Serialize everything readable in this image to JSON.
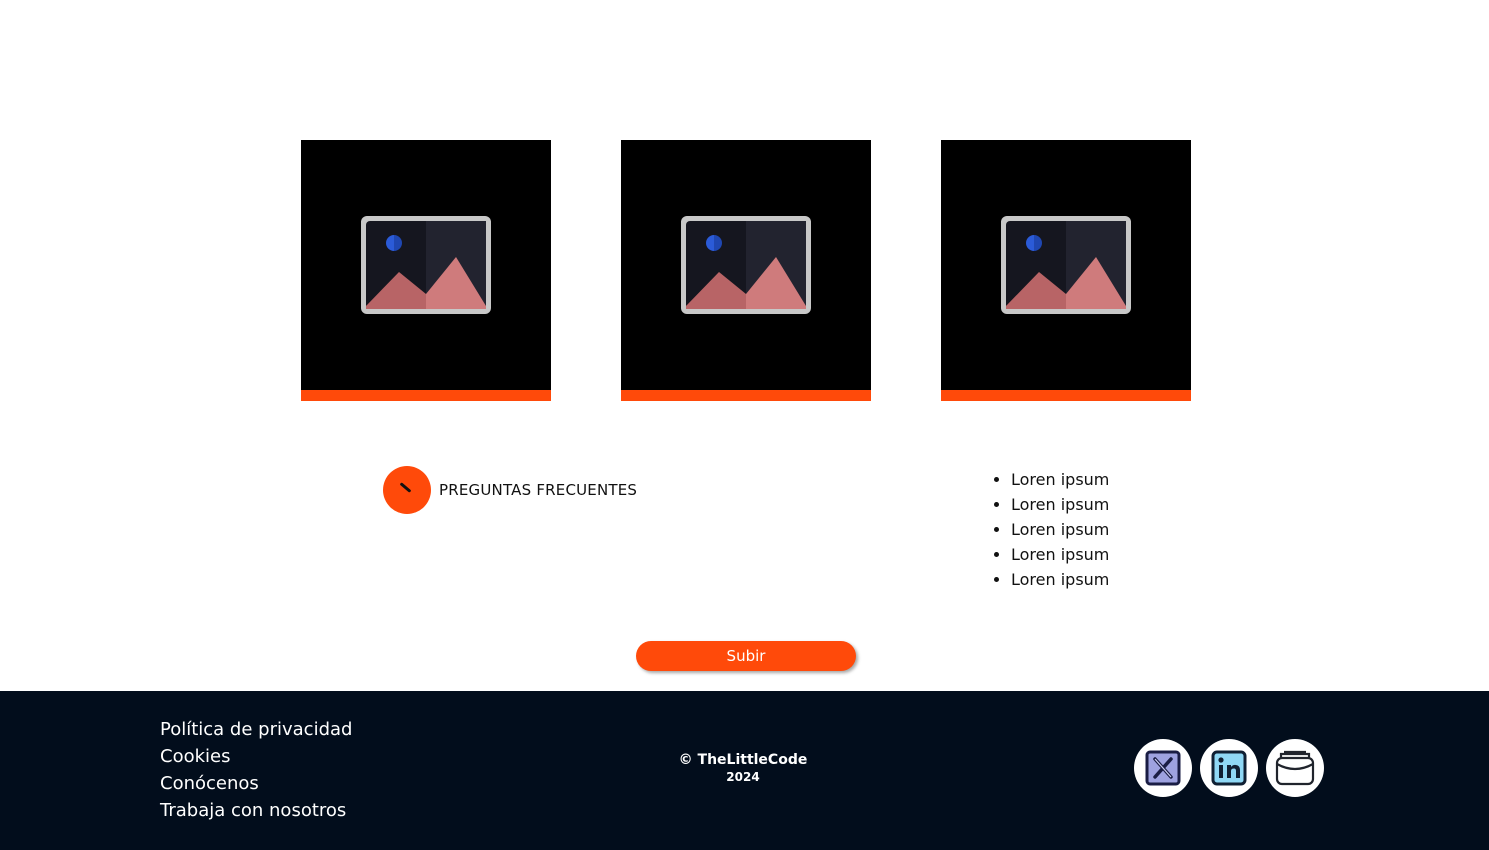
{
  "cards": [
    {
      "image_icon": "image-placeholder-icon",
      "accent": "#ff4a0a"
    },
    {
      "image_icon": "image-placeholder-icon",
      "accent": "#ff4a0a"
    },
    {
      "image_icon": "image-placeholder-icon",
      "accent": "#ff4a0a"
    }
  ],
  "faq": {
    "label": "PREGUNTAS FRECUENTES",
    "icon": "clock-icon"
  },
  "list": {
    "items": [
      "Loren ipsum",
      "Loren ipsum",
      "Loren ipsum",
      "Loren ipsum",
      "Loren ipsum"
    ]
  },
  "scroll_button": {
    "label": "Subir"
  },
  "footer": {
    "links": [
      "Política de privacidad",
      "Cookies",
      "Conócenos",
      "Trabaja con nosotros"
    ],
    "copyright": "© TheLittleCode",
    "year": "2024",
    "social": [
      "x-twitter-icon",
      "linkedin-icon",
      "wallet-icon"
    ]
  },
  "colors": {
    "accent": "#ff4a0a",
    "footer_bg": "#020d1c"
  }
}
